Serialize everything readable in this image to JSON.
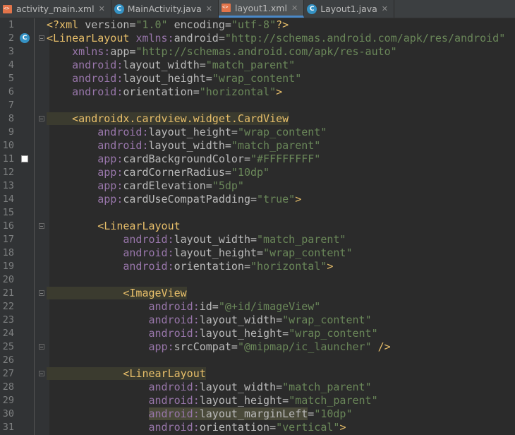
{
  "tabs": [
    {
      "label": "activity_main.xml",
      "icon": "xml-file-icon",
      "active": false
    },
    {
      "label": "MainActivity.java",
      "icon": "java-class-icon",
      "active": false
    },
    {
      "label": "layout1.xml",
      "icon": "xml-file-icon",
      "active": true
    },
    {
      "label": "Layout1.java",
      "icon": "java-class-icon",
      "active": false
    }
  ],
  "lines": [
    {
      "n": "1",
      "t": "<?xml version=\"1.0\" encoding=\"utf-8\"?>"
    },
    {
      "n": "2",
      "t": "<LinearLayout xmlns:android=\"http://schemas.android.com/apk/res/android\""
    },
    {
      "n": "3",
      "t": "    xmlns:app=\"http://schemas.android.com/apk/res-auto\""
    },
    {
      "n": "4",
      "t": "    android:layout_width=\"match_parent\""
    },
    {
      "n": "5",
      "t": "    android:layout_height=\"wrap_content\""
    },
    {
      "n": "6",
      "t": "    android:orientation=\"horizontal\">"
    },
    {
      "n": "7",
      "t": ""
    },
    {
      "n": "8",
      "t": "    <androidx.cardview.widget.CardView"
    },
    {
      "n": "9",
      "t": "        android:layout_height=\"wrap_content\""
    },
    {
      "n": "10",
      "t": "        android:layout_width=\"match_parent\""
    },
    {
      "n": "11",
      "t": "        app:cardBackgroundColor=\"#FFFFFFFF\""
    },
    {
      "n": "12",
      "t": "        app:cardCornerRadius=\"10dp\""
    },
    {
      "n": "13",
      "t": "        app:cardElevation=\"5dp\""
    },
    {
      "n": "14",
      "t": "        app:cardUseCompatPadding=\"true\">"
    },
    {
      "n": "15",
      "t": ""
    },
    {
      "n": "16",
      "t": "        <LinearLayout"
    },
    {
      "n": "17",
      "t": "            android:layout_width=\"match_parent\""
    },
    {
      "n": "18",
      "t": "            android:layout_height=\"wrap_content\""
    },
    {
      "n": "19",
      "t": "            android:orientation=\"horizontal\">"
    },
    {
      "n": "20",
      "t": ""
    },
    {
      "n": "21",
      "t": "            <ImageView"
    },
    {
      "n": "22",
      "t": "                android:id=\"@+id/imageView\""
    },
    {
      "n": "23",
      "t": "                android:layout_width=\"wrap_content\""
    },
    {
      "n": "24",
      "t": "                android:layout_height=\"wrap_content\""
    },
    {
      "n": "25",
      "t": "                app:srcCompat=\"@mipmap/ic_launcher\" />"
    },
    {
      "n": "26",
      "t": ""
    },
    {
      "n": "27",
      "t": "            <LinearLayout"
    },
    {
      "n": "28",
      "t": "                android:layout_width=\"match_parent\""
    },
    {
      "n": "29",
      "t": "                android:layout_height=\"match_parent\""
    },
    {
      "n": "30",
      "t": "                android:layout_marginLeft=\"10dp\""
    },
    {
      "n": "31",
      "t": "                android:orientation=\"vertical\">"
    }
  ],
  "colors": {
    "background": "#2b2b2b",
    "tag": "#e8bf6a",
    "namespace": "#9876aa",
    "attribute": "#bababa",
    "value": "#6a8759",
    "swatch": "#FFFFFF"
  }
}
